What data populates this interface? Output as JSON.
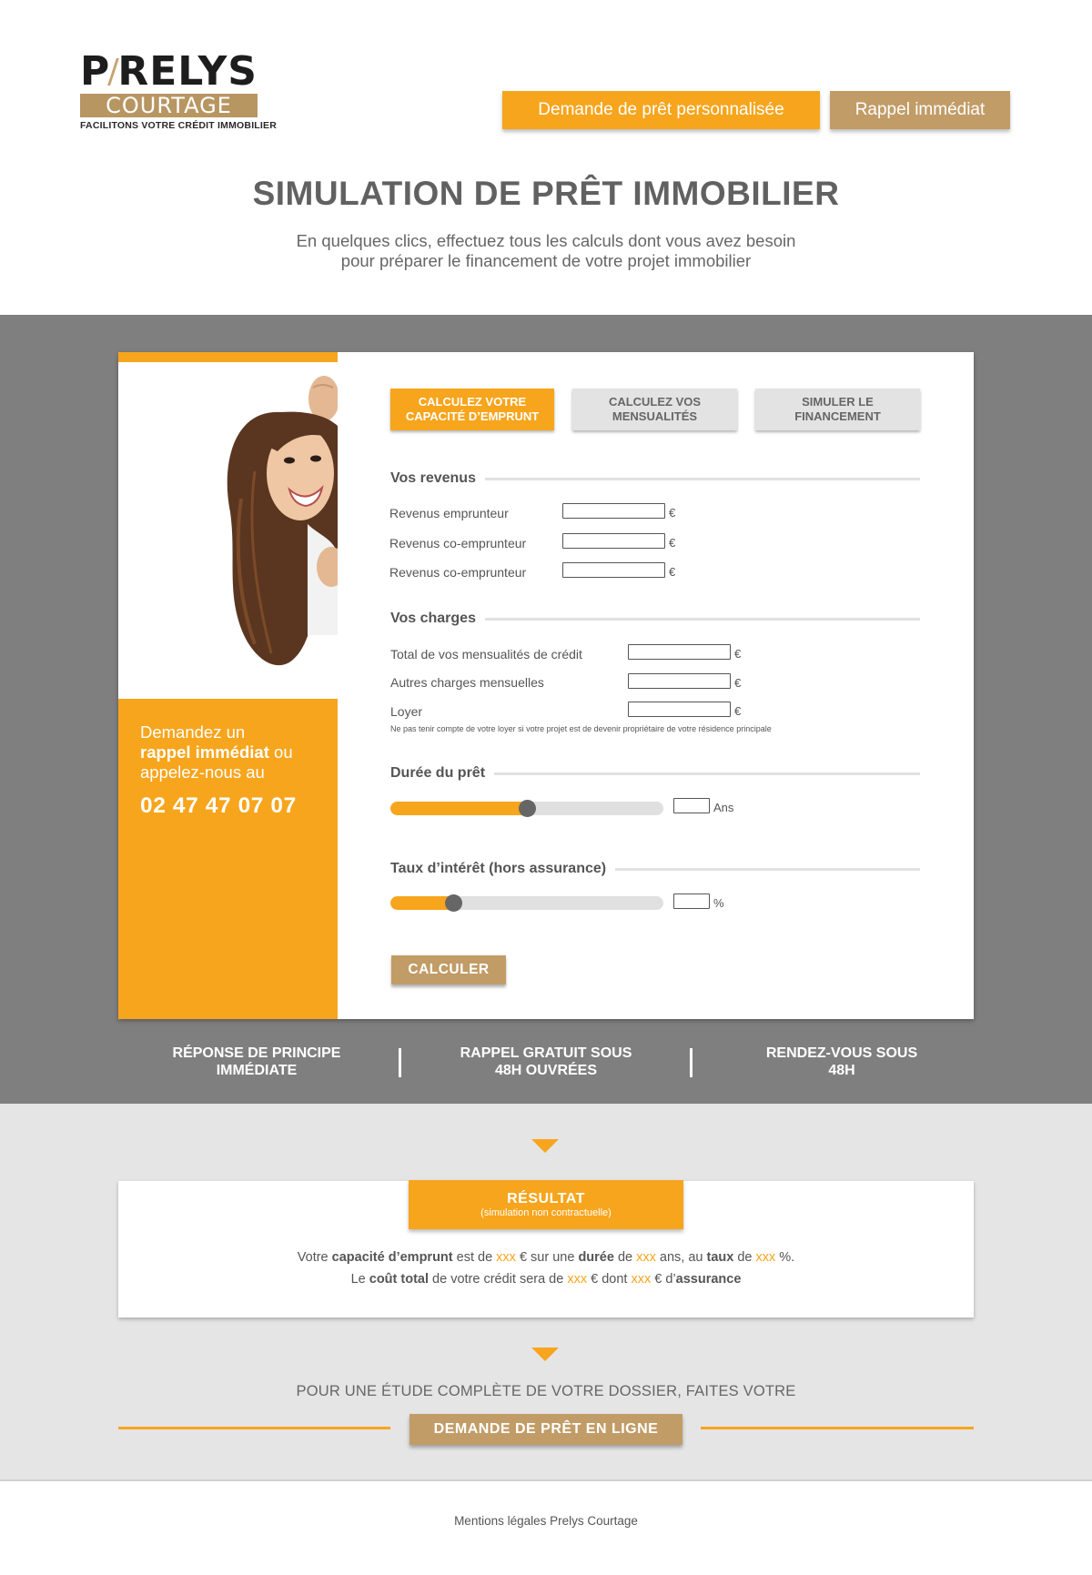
{
  "logo": {
    "brand_left": "P",
    "brand_right": "RELYS",
    "band": "COURTAGE",
    "tagline": "FACILITONS VOTRE CRÉDIT IMMOBILIER"
  },
  "header": {
    "btn_loan": "Demande de prêt personnalisée",
    "btn_callback": "Rappel immédiat"
  },
  "hero": {
    "title": "SIMULATION DE PRÊT IMMOBILIER",
    "subtitle_1": "En quelques clics, effectuez tous les calculs dont vous avez besoin",
    "subtitle_2": "pour préparer le financement de votre projet immobilier"
  },
  "callbox": {
    "line1": "Demandez un",
    "bold": "rappel immédiat",
    "line2_suffix": " ou",
    "line3": "appelez-nous au",
    "phone": "02 47 47 07 07"
  },
  "tabs": [
    {
      "line1": "Calculez votre",
      "line2": "capacité d’emprunt"
    },
    {
      "line1": "Calculez vos",
      "line2": "mensualités"
    },
    {
      "line1": "Simuler le",
      "line2": "financement"
    }
  ],
  "revenus": {
    "title": "Vos revenus",
    "rows": [
      "Revenus emprunteur",
      "Revenus co-emprunteur",
      "Revenus co-emprunteur"
    ],
    "unit": "€"
  },
  "charges": {
    "title": "Vos charges",
    "rows": [
      "Total de vos mensualités de crédit",
      "Autres charges mensuelles",
      "Loyer"
    ],
    "unit": "€",
    "note": "Ne pas tenir compte de votre loyer si votre projet est de devenir propriétaire de votre résidence principale"
  },
  "duree": {
    "title": "Durée du prêt",
    "unit": "Ans",
    "level": 0.5
  },
  "taux": {
    "title": "Taux d’intérêt (hors assurance)",
    "unit": "%",
    "level": 0.23
  },
  "calc_button": "CALCULER",
  "features": [
    {
      "line1": "RÉPONSE DE PRINCIPE",
      "line2": "IMMÉDIATE"
    },
    {
      "line1": "RAPPEL GRATUIT SOUS",
      "line2": "48H OUVRÉES"
    },
    {
      "line1": "RENDEZ-VOUS SOUS",
      "line2": "48H"
    }
  ],
  "result": {
    "title": "RÉSULTAT",
    "subtitle": "(simulation non contractuelle)",
    "l1_a": "Votre ",
    "l1_b": "capacité d’emprunt",
    "l1_c": " est de ",
    "l1_d": "xxx",
    "l1_e": " €  sur une ",
    "l1_f": "durée",
    "l1_g": " de ",
    "l1_h": "xxx",
    "l1_i": " ans, au ",
    "l1_j": "taux",
    "l1_k": " de ",
    "l1_l": "xxx",
    "l1_m": " %.",
    "l2_a": "Le ",
    "l2_b": "coût total",
    "l2_c": " de votre crédit sera de ",
    "l2_d": "xxx",
    "l2_e": " € dont ",
    "l2_f": "xxx",
    "l2_g": " € d’",
    "l2_h": "assurance"
  },
  "cta": {
    "text": "POUR UNE ÉTUDE COMPLÈTE DE VOTRE DOSSIER, FAITES VOTRE",
    "button": "DEMANDE DE PRÊT EN LIGNE"
  },
  "footer": {
    "text": "Mentions légales Prelys Courtage"
  },
  "colors": {
    "orange": "#f7a51d",
    "tan": "#c19c67",
    "grey": "#7f7f7f",
    "light_grey": "#e5e5e5"
  }
}
